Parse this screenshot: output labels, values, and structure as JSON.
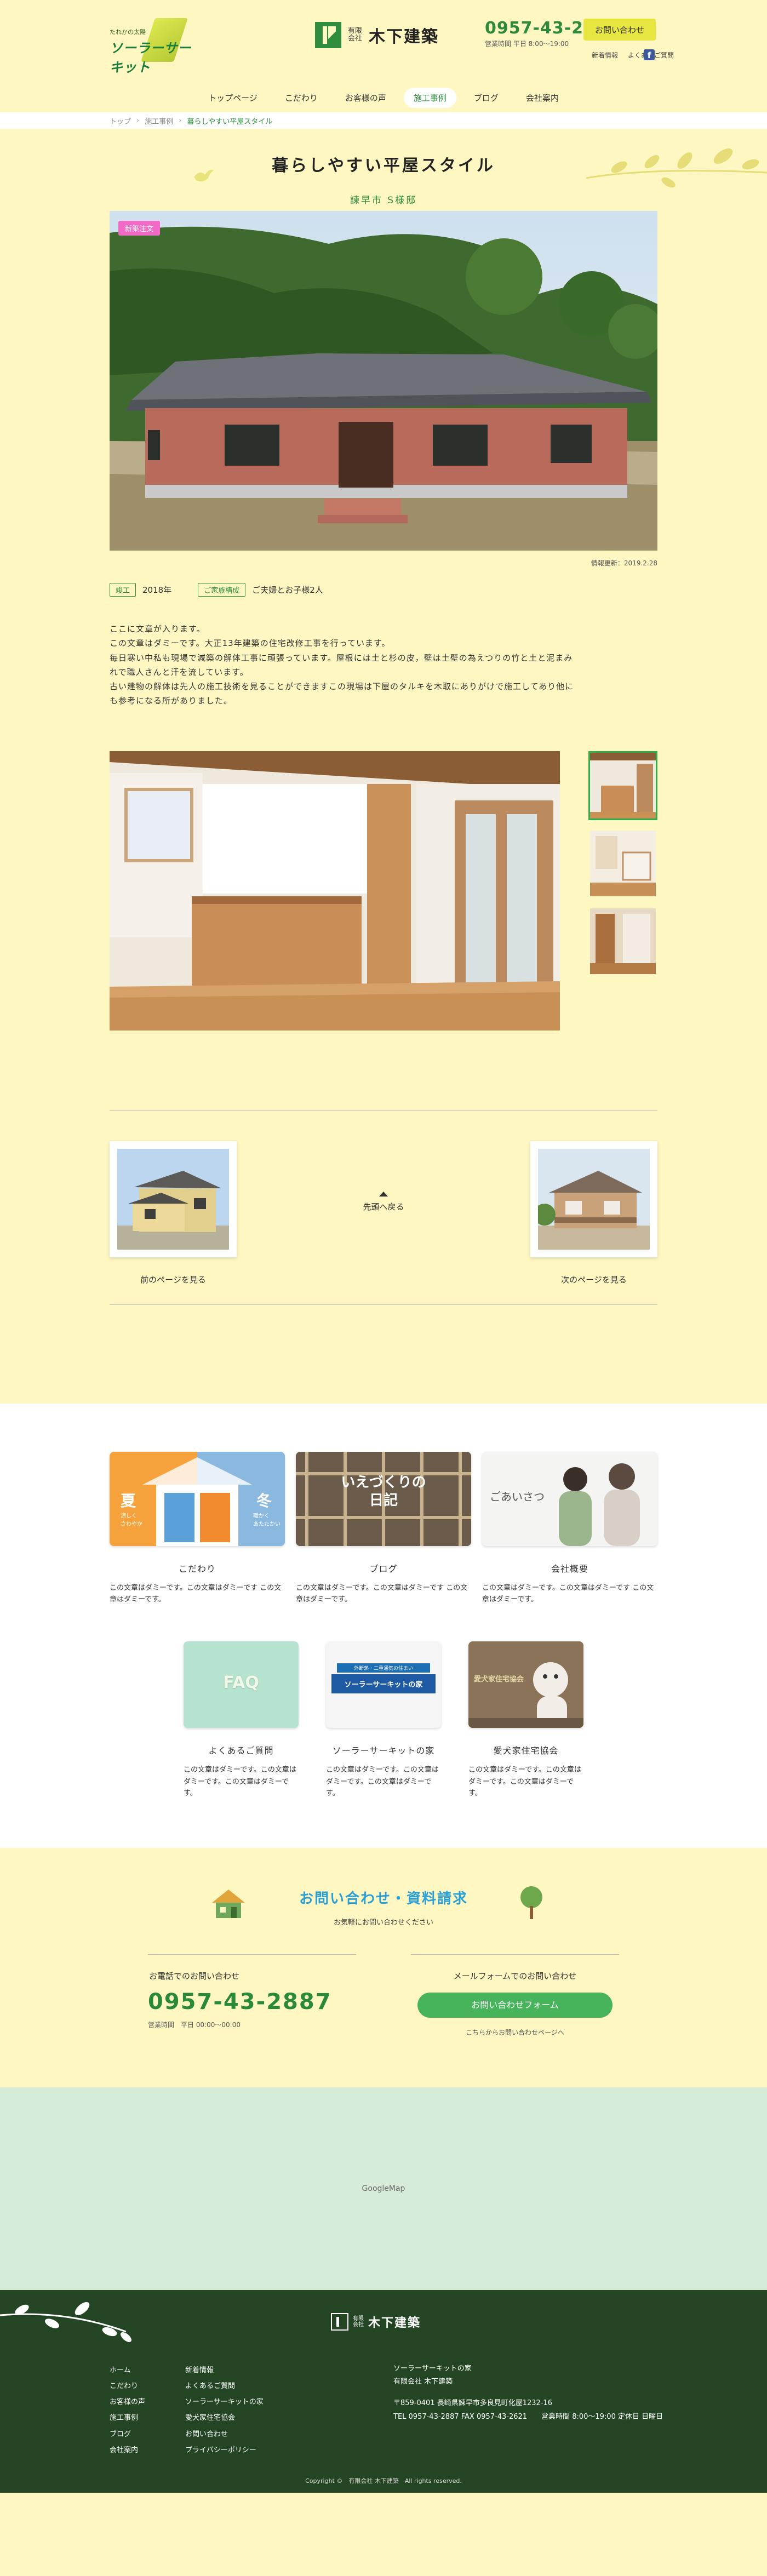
{
  "header": {
    "tagline": "たれかの太陽",
    "brand": "ソーラーサーキット",
    "company_sub": "有限\n会社",
    "company_name": "木下建築",
    "tel": "0957-43-2887",
    "hours": "営業時間 平日 8:00〜19:00",
    "contact_label": "お問い合わせ",
    "news_label": "新着情報",
    "faq_label": "よくあるご質問"
  },
  "nav": [
    {
      "label": "トップページ"
    },
    {
      "label": "こだわり"
    },
    {
      "label": "お客様の声"
    },
    {
      "label": "施工事例"
    },
    {
      "label": "ブログ"
    },
    {
      "label": "会社案内"
    }
  ],
  "breadcrumb": {
    "home": "トップ",
    "section": "施工事例",
    "current": "暮らしやすい平屋スタイル"
  },
  "article": {
    "title": "暮らしやすい平屋スタイル",
    "subtitle": "諫早市 S様邸",
    "badge": "新築注文",
    "updated": "情報更新：2019.2.28",
    "completion_tag": "竣工",
    "completion_year": "2018年",
    "family_tag": "ご家族構成",
    "family": "ご夫婦とお子様2人",
    "body": [
      "ここに文章が入ります。",
      "この文章はダミーです。大正13年建築の住宅改修工事を行っています。",
      "毎日寒い中私も現場で減築の解体工事に頑張っています。屋根には土と杉の皮，壁は土壁の為えつりの竹と土と泥まみ",
      "れで職人さんと汗を流しています。",
      "古い建物の解体は先人の施工技術を見ることができますこの現場は下屋のタルキを木取にありがけで施工してあり他に",
      "も参考になる所がありました。"
    ]
  },
  "pager": {
    "prev": "前のページを見る",
    "top": "先頭へ戻る",
    "next": "次のページを見る"
  },
  "cards": [
    {
      "title": "こだわり",
      "desc": "この文章はダミーです。この文章はダミーです この文章はダミーです。",
      "badge_a": "夏",
      "badge_a_sub": "涼しく\nさわやか",
      "badge_b": "冬",
      "badge_b_sub": "暖かく\nあたたかい"
    },
    {
      "title": "ブログ",
      "desc": "この文章はダミーです。この文章はダミーです この文章はダミーです。",
      "overlay": "いえづくりの\n日記"
    },
    {
      "title": "会社概要",
      "desc": "この文章はダミーです。この文章はダミーです この文章はダミーです。",
      "overlay": "ごあいさつ"
    },
    {
      "title": "よくあるご質問",
      "desc": "この文章はダミーです。この文章はダミーです。この文章はダミーです。",
      "overlay": "FAQ"
    },
    {
      "title": "ソーラーサーキットの家",
      "desc": "この文章はダミーです。この文章はダミーです。この文章はダミーです。",
      "overlay_small": "外断熱・二重通気の住まい",
      "overlay": "ソーラーサーキットの家"
    },
    {
      "title": "愛犬家住宅協会",
      "desc": "この文章はダミーです。この文章はダミーです。この文章はダミーです。",
      "overlay": "愛犬家住宅協会"
    }
  ],
  "contact": {
    "title": "お問い合わせ・資料請求",
    "lead": "お気軽にお問い合わせください",
    "phone_heading": "お電話でのお問い合わせ",
    "phone": "0957-43-2887",
    "phone_hours": "営業時間　平日 00:00〜00:00",
    "form_heading": "メールフォームでのお問い合わせ",
    "form_button": "お問い合わせフォーム",
    "form_note": "こちらからお問い合わせページへ"
  },
  "map": {
    "label": "GoogleMap"
  },
  "footer": {
    "company_sub": "有限\n会社",
    "company_name": "木下建築",
    "nav1": [
      "ホーム",
      "こだわり",
      "お客様の声",
      "施工事例",
      "ブログ",
      "会社案内"
    ],
    "nav2": [
      "新着情報",
      "よくあるご質問",
      "ソーラーサーキットの家",
      "愛犬家住宅協会",
      "お問い合わせ",
      "プライバシーポリシー"
    ],
    "info_line1": "ソーラーサーキットの家",
    "info_line2": "有限会社 木下建築",
    "address": "〒859-0401 長崎県諫早市多良見町化屋1232-16",
    "tel_line": "TEL 0957-43-2887 FAX 0957-43-2621　　営業時間 8:00〜19:00 定休日 日曜日",
    "copyright": "Copyright ©　有限会社 木下建築　All rights reserved."
  },
  "colors": {
    "background": "#fff7c2",
    "accent_green": "#2a8a3a",
    "contact_blue": "#2a9fd6",
    "footer_green": "#234524",
    "badge_pink": "#f06ac6",
    "button_yellow": "#e8e640"
  }
}
